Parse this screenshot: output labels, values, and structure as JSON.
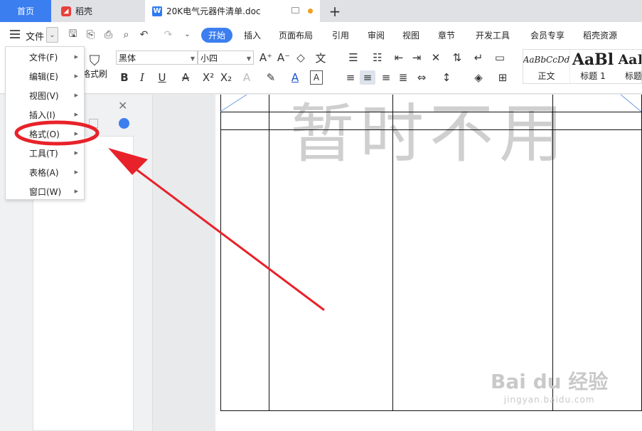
{
  "tabs": {
    "home": "首页",
    "daoke": "稻壳",
    "doc": "20K电气元器件清单.doc",
    "add": "+"
  },
  "menubar": {
    "file": "文件",
    "tabs": [
      "开始",
      "插入",
      "页面布局",
      "引用",
      "审阅",
      "视图",
      "章节",
      "开发工具",
      "会员专享",
      "稻壳资源"
    ]
  },
  "toolbar": {
    "format_brush": "格式刷",
    "font": "黑体",
    "size": "小四",
    "styles": [
      {
        "preview": "AaBbCcDd",
        "name": "正文"
      },
      {
        "preview": "AaBl",
        "name": "标题 1"
      },
      {
        "preview": "AaB",
        "name": "标题"
      }
    ]
  },
  "file_menu": {
    "items": [
      {
        "label": "文件(F)"
      },
      {
        "label": "编辑(E)"
      },
      {
        "label": "视图(V)"
      },
      {
        "label": "插入(I)"
      },
      {
        "label": "格式(O)"
      },
      {
        "label": "工具(T)"
      },
      {
        "label": "表格(A)"
      },
      {
        "label": "窗口(W)"
      }
    ]
  },
  "document": {
    "watermark": "暂时不用"
  },
  "brand_watermark": {
    "line1": "Bai du 经验",
    "line2": "jingyan.baidu.com"
  },
  "colors": {
    "accent": "#3b7ef0",
    "annotation": "#e8222a"
  }
}
